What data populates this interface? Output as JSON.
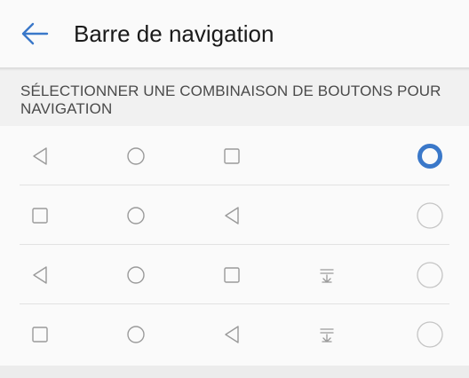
{
  "header": {
    "title": "Barre de navigation",
    "back_icon": "arrow-left-icon"
  },
  "section": {
    "label": "SÉLECTIONNER UNE COMBINAISON DE BOUTONS POUR NAVIGATION"
  },
  "colors": {
    "accent": "#3a78c9",
    "icon": "#9a9a9a",
    "radio_border": "#c4c4c4"
  },
  "options": [
    {
      "buttons": [
        "back-triangle-icon",
        "home-circle-icon",
        "recents-square-icon"
      ],
      "selected": true
    },
    {
      "buttons": [
        "recents-square-icon",
        "home-circle-icon",
        "back-triangle-icon"
      ],
      "selected": false
    },
    {
      "buttons": [
        "back-triangle-icon",
        "home-circle-icon",
        "recents-square-icon",
        "notification-pulldown-icon"
      ],
      "selected": false
    },
    {
      "buttons": [
        "recents-square-icon",
        "home-circle-icon",
        "back-triangle-icon",
        "notification-pulldown-icon"
      ],
      "selected": false
    }
  ]
}
